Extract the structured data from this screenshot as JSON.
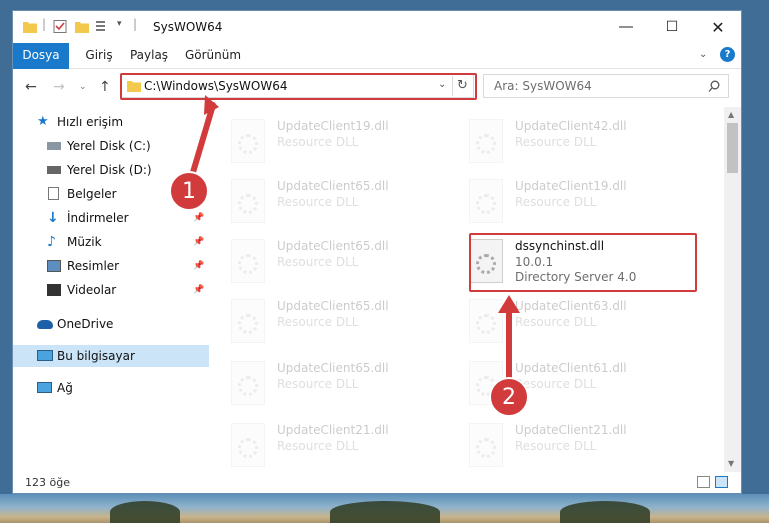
{
  "window": {
    "title": "SysWOW64"
  },
  "ribbon": {
    "tabs": [
      "Dosya",
      "Giriş",
      "Paylaş",
      "Görünüm"
    ]
  },
  "address": {
    "path": "C:\\Windows\\SysWOW64"
  },
  "search": {
    "placeholder": "Ara: SysWOW64"
  },
  "sidebar": {
    "items": [
      {
        "label": "Hızlı erişim"
      },
      {
        "label": "Yerel Disk (C:)"
      },
      {
        "label": "Yerel Disk (D:)"
      },
      {
        "label": "Belgeler"
      },
      {
        "label": "İndirmeler"
      },
      {
        "label": "Müzik"
      },
      {
        "label": "Resimler"
      },
      {
        "label": "Videolar"
      },
      {
        "label": "OneDrive"
      },
      {
        "label": "Bu bilgisayar"
      },
      {
        "label": "Ağ"
      }
    ]
  },
  "files": [
    {
      "name": "UpdateClient19.dll",
      "desc": "Resource DLL"
    },
    {
      "name": "UpdateClient42.dll",
      "desc": "Resource DLL"
    },
    {
      "name": "UpdateClient65.dll",
      "desc": "Resource DLL"
    },
    {
      "name": "UpdateClient19.dll",
      "desc": "Resource DLL"
    },
    {
      "name": "UpdateClient65.dll",
      "desc": "Resource DLL"
    },
    {
      "name": "UpdateClient65.dll",
      "desc": "Resource DLL"
    },
    {
      "name": "UpdateClient63.dll",
      "desc": "Resource DLL"
    },
    {
      "name": "UpdateClient65.dll",
      "desc": "Resource DLL"
    },
    {
      "name": "UpdateClient61.dll",
      "desc": "Resource DLL"
    },
    {
      "name": "UpdateClient21.dll",
      "desc": "Resource DLL"
    },
    {
      "name": "UpdateClient21.dll",
      "desc": "Resource DLL"
    }
  ],
  "highlighted_file": {
    "name": "dssynchinst.dll",
    "version": "10.0.1",
    "description": "Directory Server 4.0"
  },
  "status": {
    "count": "123 öğe"
  },
  "callouts": {
    "one": "1",
    "two": "2"
  },
  "colors": {
    "accent": "#1979ca",
    "highlight": "#d23b3b",
    "selected": "#cce4f7"
  }
}
